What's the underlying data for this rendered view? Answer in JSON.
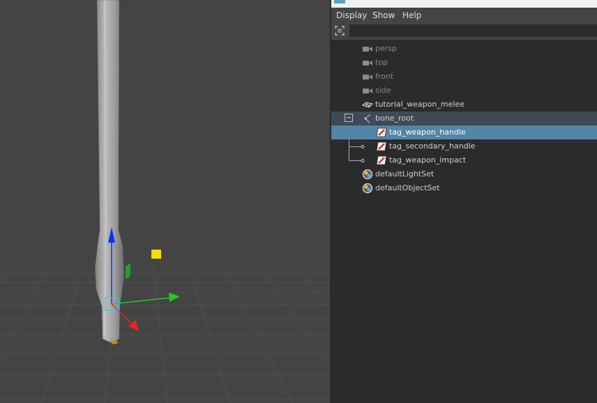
{
  "outliner": {
    "menu": [
      "Display",
      "Show",
      "Help"
    ],
    "search": {
      "value": "",
      "placeholder": ""
    },
    "items": [
      {
        "label": "persp",
        "icon": "camera-icon"
      },
      {
        "label": "top",
        "icon": "camera-icon"
      },
      {
        "label": "front",
        "icon": "camera-icon"
      },
      {
        "label": "side",
        "icon": "camera-icon"
      },
      {
        "label": "tutorial_weapon_melee",
        "icon": "mesh-icon"
      },
      {
        "label": "bone_root",
        "icon": "joint-icon"
      },
      {
        "label": "tag_weapon_handle",
        "icon": "tag-icon"
      },
      {
        "label": "tag_secondary_handle",
        "icon": "tag-icon"
      },
      {
        "label": "tag_weapon_impact",
        "icon": "tag-icon"
      },
      {
        "label": "defaultLightSet",
        "icon": "set-icon"
      },
      {
        "label": "defaultObjectSet",
        "icon": "set-icon"
      }
    ],
    "selected": "tag_weapon_handle"
  },
  "colors": {
    "viewport_bg": "#444444",
    "panel_bg": "#2b2b2b",
    "selection": "#5285a6",
    "gizmo_y": "#1030ff",
    "gizmo_x": "#22cc22",
    "gizmo_z": "#ee2222"
  }
}
